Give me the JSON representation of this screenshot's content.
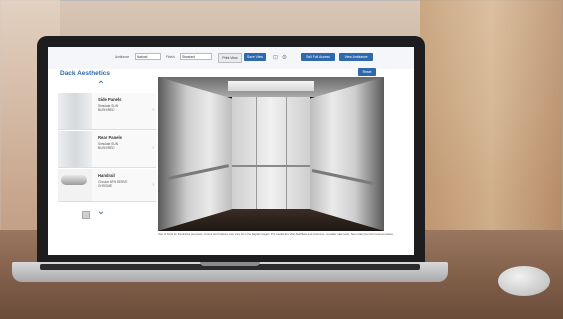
{
  "toolbar": {
    "ambiance_label": "Ambiance",
    "ambiance_value": "Natural",
    "finish_label": "Finish",
    "finish_value": "Standard",
    "print_view": "Print View",
    "save_view": "Save View",
    "sell_full_access": "Sell Full Access",
    "view_ambiance": "View Ambiance"
  },
  "panel": {
    "title": "Dack Aesthetics",
    "reset": "Reset"
  },
  "side_items": [
    {
      "name": "Side Panels",
      "desc": "Simulate SUN\nBUSH/RED"
    },
    {
      "name": "Rear Panels",
      "desc": "Simulate SUN\nBUSH/RED"
    },
    {
      "name": "Handrail",
      "desc": "Circular 6FN SERVE\nCHROME"
    }
  ],
  "disclaimer": "Use of Ambi for illustrative purposes. Colors and finishes may vary from the Digital images. Pro Aesthetics Visit Swiftfield and customer, consider sale tests. See retail your limit representative."
}
